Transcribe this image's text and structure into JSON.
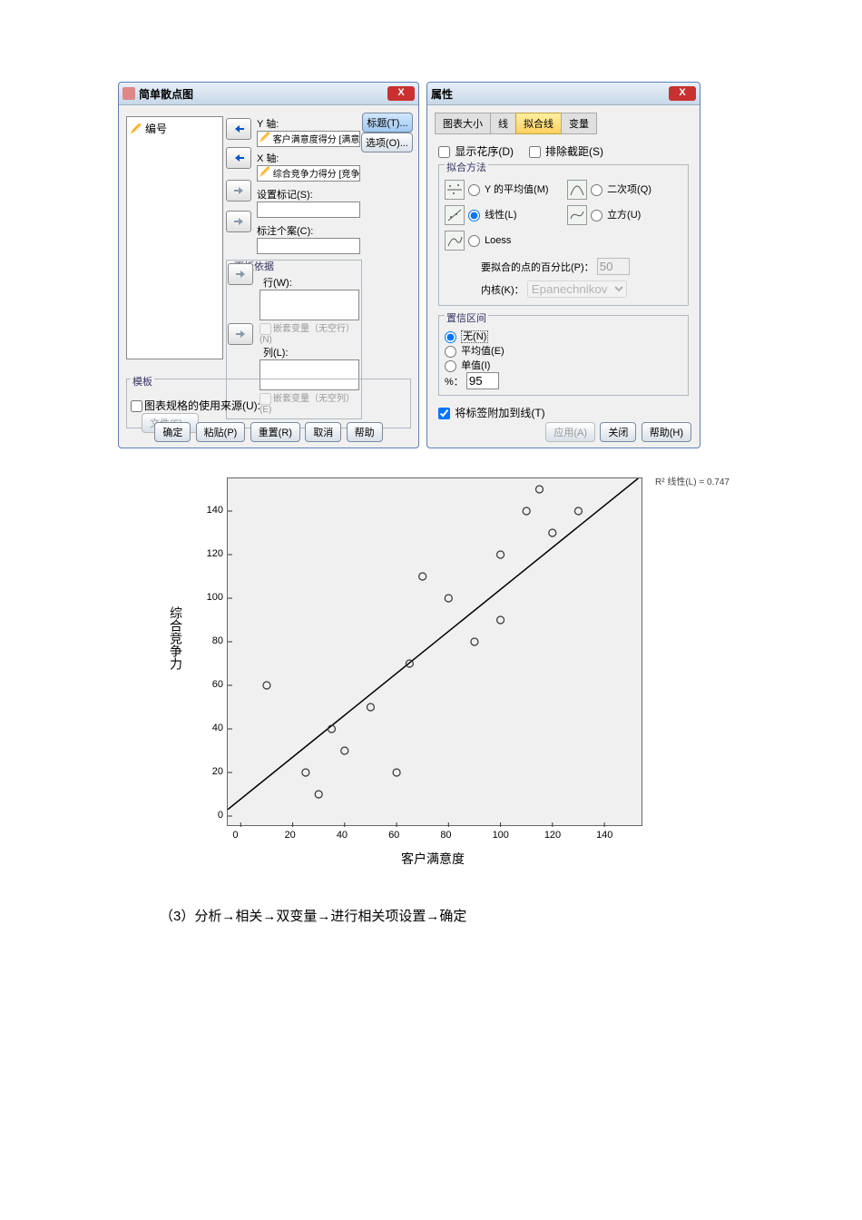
{
  "dialog1": {
    "title": "简单散点图",
    "varlist_item": "编号",
    "y_label": "Y 轴:",
    "y_value": "客户满意度得分 [满意...",
    "x_label": "X 轴:",
    "x_value": "综合竞争力得分 [竞争...",
    "setmark_label": "设置标记(S):",
    "annotate_label": "标注个案(C):",
    "panel_title": "面板依据",
    "row_label": "行(W):",
    "nest_row": "嵌套变量（无空行）(N)",
    "col_label": "列(L):",
    "nest_col": "嵌套变量（无空列）(E)",
    "tmpl_title": "模板",
    "tmpl_chk": "图表规格的使用来源(U):",
    "tmpl_btn": "文件(F)...",
    "btn_ok": "确定",
    "btn_paste": "粘贴(P)",
    "btn_reset": "重置(R)",
    "btn_cancel": "取消",
    "btn_help": "帮助",
    "btn_title": "标题(T)...",
    "btn_options": "选项(O)..."
  },
  "dialog2": {
    "title": "属性",
    "tabs": [
      "图表大小",
      "线",
      "拟合线",
      "变量"
    ],
    "active_tab": 2,
    "show_spikes": "显示花序(D)",
    "exclude_intercept": "排除截距(S)",
    "fit_title": "拟合方法",
    "fit_ymean": "Y 的平均值(M)",
    "fit_quad": "二次项(Q)",
    "fit_linear": "线性(L)",
    "fit_cubic": "立方(U)",
    "fit_loess": "Loess",
    "loess_pct_label": "要拟合的点的百分比(P)：",
    "loess_pct": "50",
    "kernel_label": "内核(K)：",
    "kernel_value": "Epanechnikov",
    "ci_title": "置信区间",
    "ci_none": "无(N)",
    "ci_mean": "平均值(E)",
    "ci_indiv": "单值(I)",
    "ci_pct_label": "%：",
    "ci_pct": "95",
    "attach_label": "将标签附加到线(T)",
    "btn_apply": "应用(A)",
    "btn_close": "关闭",
    "btn_help": "帮助(H)"
  },
  "chart_data": {
    "type": "scatter",
    "xlabel": "客户满意度",
    "ylabel": "综合竞争力",
    "xlim": [
      -5,
      155
    ],
    "ylim": [
      -5,
      155
    ],
    "xticks": [
      0,
      20,
      40,
      60,
      80,
      100,
      120,
      140
    ],
    "yticks": [
      0,
      20,
      40,
      60,
      80,
      100,
      120,
      140
    ],
    "points": [
      [
        10,
        60
      ],
      [
        25,
        20
      ],
      [
        30,
        10
      ],
      [
        35,
        40
      ],
      [
        40,
        30
      ],
      [
        50,
        50
      ],
      [
        60,
        20
      ],
      [
        65,
        70
      ],
      [
        70,
        110
      ],
      [
        80,
        100
      ],
      [
        90,
        80
      ],
      [
        100,
        120
      ],
      [
        100,
        90
      ],
      [
        110,
        140
      ],
      [
        115,
        150
      ],
      [
        120,
        130
      ],
      [
        130,
        140
      ]
    ],
    "fit": {
      "type": "linear",
      "x0": -5,
      "y0": 3,
      "x1": 153,
      "y1": 155
    },
    "annotation": "R² 线性(L) = 0.747"
  },
  "footnote": "（3）分析→相关→双变量→进行相关项设置→确定"
}
